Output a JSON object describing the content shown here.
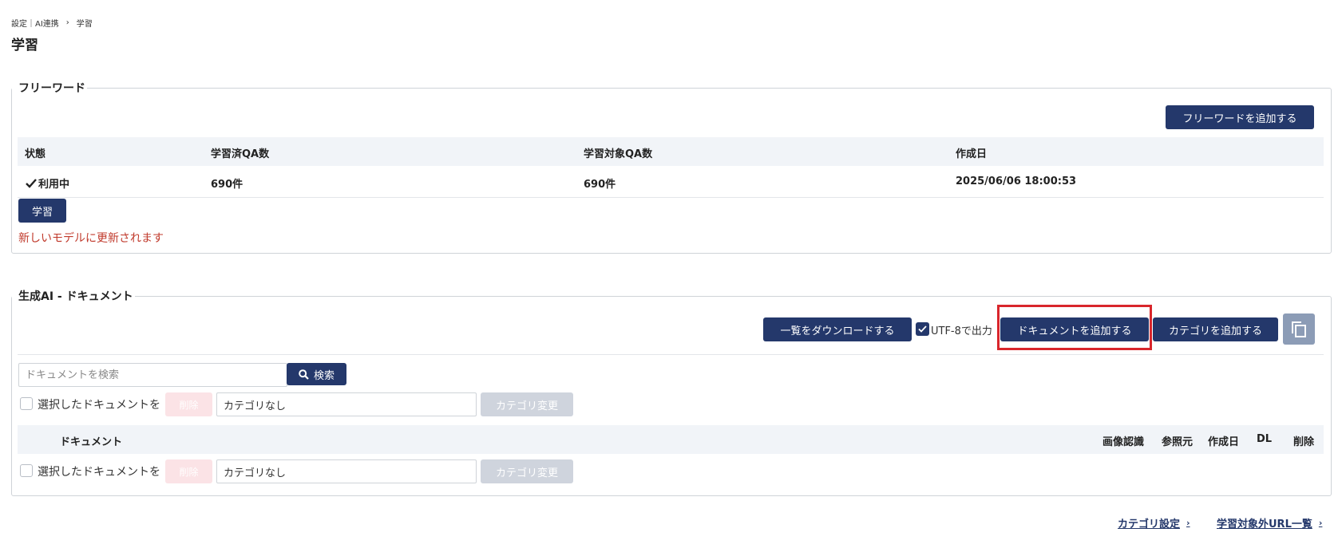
{
  "breadcrumb": {
    "parent": "設定｜AI連携",
    "separator": "›",
    "current": "学習"
  },
  "page_title": "学習",
  "freeword": {
    "legend": "フリーワード",
    "add_button": "フリーワードを追加する",
    "columns": [
      "状態",
      "学習済QA数",
      "学習対象QA数",
      "作成日"
    ],
    "row": {
      "status": "利用中",
      "learned_qa": "690件",
      "target_qa": "690件",
      "created": "2025/06/06 18:00:53"
    },
    "learn_button": "学習",
    "notice": "新しいモデルに更新されます",
    "notice_color": "#c0392b"
  },
  "documents": {
    "legend": "生成AI - ドキュメント",
    "download_button": "一覧をダウンロードする",
    "utf8_label": "UTF-8で出力",
    "utf8_checked": true,
    "add_document_button": "ドキュメントを追加する",
    "add_category_button": "カテゴリを追加する",
    "search_placeholder": "ドキュメントを検索",
    "search_button": "検索",
    "bulk_label": "選択したドキュメントを",
    "delete_button": "削除",
    "category_value": "カテゴリなし",
    "change_category_button": "カテゴリ変更",
    "columns": {
      "document": "ドキュメント",
      "image_recognition": "画像認識",
      "reference": "参照元",
      "created": "作成日",
      "dl": "DL",
      "delete": "削除"
    }
  },
  "footer": {
    "category_settings": "カテゴリ設定",
    "excluded_urls": "学習対象外URL一覧"
  },
  "colors": {
    "navy": "#24386b",
    "highlight": "#d9262c",
    "copy_button": "#8c9cb6"
  }
}
